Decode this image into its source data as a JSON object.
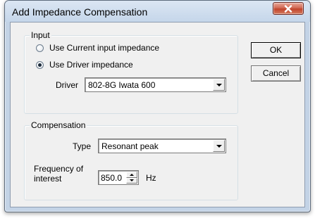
{
  "window": {
    "title": "Add Impedance Compensation"
  },
  "input_group": {
    "legend": "Input",
    "radio_current": "Use Current input impedance",
    "radio_driver": "Use Driver impedance",
    "driver_label": "Driver",
    "driver_value": "802-8G Iwata 600"
  },
  "compensation_group": {
    "legend": "Compensation",
    "type_label": "Type",
    "type_value": "Resonant peak",
    "freq_label_line1": "Frequency of",
    "freq_label_line2": "interest",
    "freq_value": "850.0",
    "freq_unit": "Hz"
  },
  "buttons": {
    "ok": "OK",
    "cancel": "Cancel"
  },
  "icons": {
    "close": "close-icon",
    "dropdown": "chevron-down-icon",
    "spin_up": "arrow-up-icon",
    "spin_down": "arrow-down-icon"
  },
  "colors": {
    "close_button": "#c1442c",
    "frame": "#c3d3e6",
    "client": "#f0f0f0"
  }
}
